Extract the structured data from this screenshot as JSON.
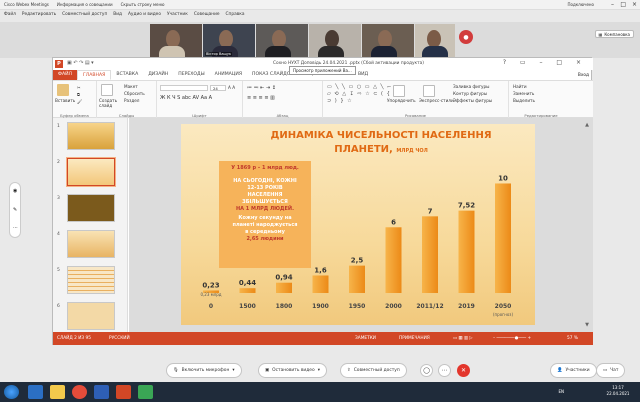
{
  "webex": {
    "app_title": "Cisco Webex Meetings",
    "session_info": "Информация о совещании",
    "hide_menu": "Скрыть строку меню",
    "connection": "Подключено",
    "menu": [
      "Файл",
      "Редактировать",
      "Совместный доступ",
      "Вид",
      "Аудио и видео",
      "Участник",
      "Совещание",
      "Справка"
    ],
    "participant_name": "Віктор Ващук",
    "kompan_label": "Компановка",
    "controls": {
      "mic": "Включить микрофон",
      "video": "Остановить видео",
      "share": "Совместный доступ",
      "participants": "Участники",
      "chat": "Чат"
    }
  },
  "ppt": {
    "doc_title": "Сохно НУХТ Доповідь 24.04.2021 .pptx (Сбой активации продукта)",
    "tooltip": "Просмотр приложений Ва...",
    "tabs": [
      "ФАЙЛ",
      "ГЛАВНАЯ",
      "ВСТАВКА",
      "ДИЗАЙН",
      "ПЕРЕХОДЫ",
      "АНИМАЦИЯ",
      "ПОКАЗ СЛАЙДОВ",
      "РЕЦЕНЗИРОВАНИЕ",
      "ВИД"
    ],
    "login": "Вход",
    "ribbon": {
      "paste": "Вставить",
      "create_slide": "Создать слайд",
      "layout": "Макет",
      "reset": "Сбросить",
      "section": "Раздел",
      "arrange": "Упорядочить",
      "quick_styles": "Экспресс-стили",
      "shape_fill": "Заливка фигуры",
      "shape_outline": "Контур фигуры",
      "shape_effects": "Эффекты фигуры",
      "find": "Найти",
      "replace": "Заменить",
      "select": "Выделить",
      "cap_clipboard": "Буфер обмена",
      "cap_slides": "Слайды",
      "cap_font": "Шрифт",
      "cap_paragraph": "Абзац",
      "cap_draw": "Рисование",
      "cap_edit": "Редактирование",
      "font_size": "24"
    },
    "thumb_numbers": [
      "1",
      "2",
      "3",
      "4",
      "5",
      "6"
    ],
    "status": {
      "slide": "СЛАЙД 2 ИЗ 95",
      "lang": "РУССКИЙ",
      "notes": "ЗАМЕТКИ",
      "comments": "ПРИМЕЧАНИЯ",
      "zoom": "57 %"
    }
  },
  "slide": {
    "title_line1": "ДИНАМІКА ЧИСЕЛЬНОСТІ НАСЕЛЕННЯ",
    "title_line2": "ПЛАНЕТИ,",
    "title_unit": "МЛРД ЧОЛ",
    "info": {
      "line1": "У 1869 р – 1 млрд люд.",
      "line2": "НА СЬОГОДНІ, КОЖНІ",
      "line3": "12-13 РОКІВ",
      "line4": "НАСЕЛЕННЯ",
      "line5": "ЗБІЛЬШУЄТЬСЯ",
      "line6": "НА 1 МЛРД ЛЮДЕЙ.",
      "line7": "Кожну секунду на",
      "line8": "планеті народжується",
      "line9": "в середньому",
      "line10": "2,65 людини"
    }
  },
  "chart_data": {
    "type": "bar",
    "categories": [
      "0",
      "1500",
      "1800",
      "1900",
      "1950",
      "2000",
      "2011/12",
      "2019",
      "2050"
    ],
    "values": [
      0.23,
      0.44,
      0.94,
      1.6,
      2.5,
      6,
      7,
      7.52,
      10
    ],
    "value_labels": [
      "0,23",
      "0,44",
      "0,94",
      "1,6",
      "2,5",
      "6",
      "7",
      "7,52",
      "10"
    ],
    "highlight_category": "2011/12",
    "note_first": "0,23 млрд",
    "note_last": "(прогноз)",
    "title": "ДИНАМІКА ЧИСЕЛЬНОСТІ НАСЕЛЕННЯ ПЛАНЕТИ, МЛРД ЧОЛ",
    "ylim": [
      0,
      10.5
    ],
    "grid": false,
    "legend": "none",
    "colors": {
      "bar": "#f39c28",
      "highlight": "#c0392b"
    }
  },
  "taskbar": {
    "lang": "EN",
    "time": "13:17",
    "date": "22.04.2021"
  }
}
